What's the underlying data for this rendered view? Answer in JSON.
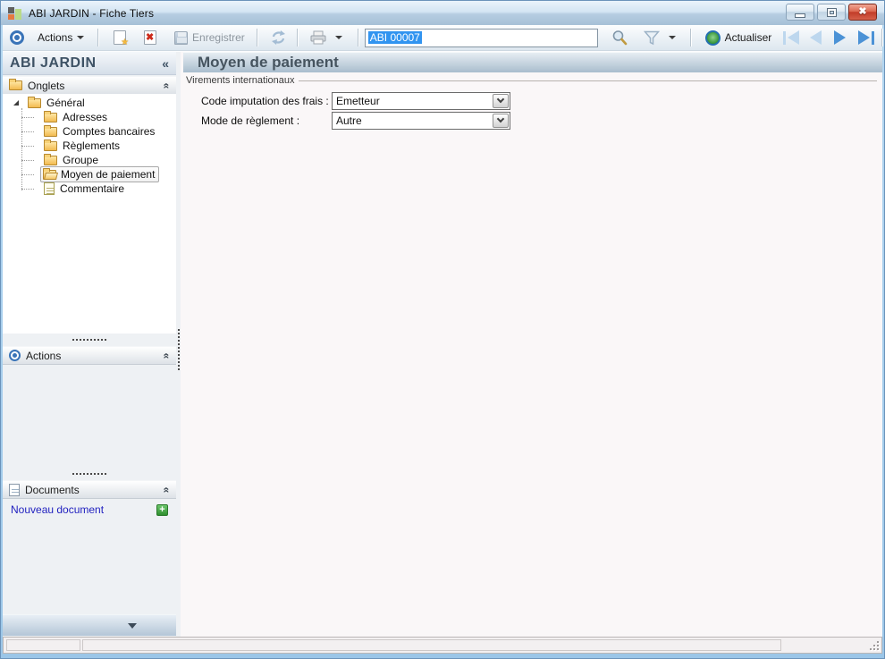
{
  "window": {
    "title": "ABI JARDIN -  Fiche Tiers"
  },
  "toolbar": {
    "actions_label": "Actions",
    "save_label": "Enregistrer",
    "record_value": "ABI 00007",
    "refresh_label": "Actualiser"
  },
  "sidebar": {
    "title": "ABI JARDIN",
    "collapse_glyph": "«",
    "onglets_label": "Onglets",
    "actions_label": "Actions",
    "documents_label": "Documents",
    "new_document_label": "Nouveau document",
    "add_document_glyph": "+",
    "tree": {
      "selected": "Moyen de paiement",
      "items": [
        {
          "label": "Général",
          "icon": "folder",
          "level": 0
        },
        {
          "label": "Adresses",
          "icon": "folder",
          "level": 1
        },
        {
          "label": "Comptes bancaires",
          "icon": "folder",
          "level": 1
        },
        {
          "label": "Règlements",
          "icon": "folder",
          "level": 1
        },
        {
          "label": "Groupe",
          "icon": "folder",
          "level": 1
        },
        {
          "label": "Moyen de paiement",
          "icon": "folder-open",
          "level": 1
        },
        {
          "label": "Commentaire",
          "icon": "note",
          "level": 1
        }
      ]
    }
  },
  "main": {
    "title": "Moyen de paiement",
    "group_label": "Virements internationaux",
    "fields": [
      {
        "label": "Code imputation des frais :",
        "value": "Emetteur"
      },
      {
        "label": "Mode de règlement :",
        "value": "Autre"
      }
    ]
  },
  "icons": {
    "chevron_collapse_left": "«",
    "close_glyph": "✖"
  },
  "colors": {
    "titlebar_top": "#eaf3fb",
    "titlebar_bottom": "#a6c0d7",
    "close_button": "#c23c28",
    "selection_highlight": "#3194f0",
    "link_blue": "#1f1fbf",
    "add_green": "#2f8f2f",
    "header_text": "#46545f",
    "nav_enabled": "#4b92d6",
    "nav_disabled": "#bdd7ee",
    "folder_gold": "#f2bb50"
  }
}
